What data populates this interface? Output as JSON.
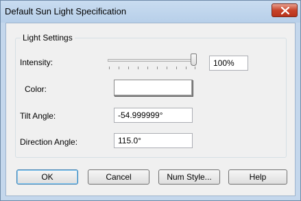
{
  "window": {
    "title": "Default Sun Light Specification"
  },
  "group": {
    "title": "Light Settings"
  },
  "intensity": {
    "label": "Intensity:",
    "value": "100%",
    "slider_fraction": 1.0
  },
  "color": {
    "label": "Color:",
    "swatch": "#ffffff"
  },
  "tilt": {
    "label": "Tilt Angle:",
    "value": "-54.999999°"
  },
  "direction": {
    "label": "Direction Angle:",
    "value": "115.0°"
  },
  "buttons": {
    "ok": "OK",
    "cancel": "Cancel",
    "num_style": "Num Style...",
    "help": "Help"
  },
  "icons": {
    "close": "close-icon"
  },
  "colors": {
    "close_button": "#c7432a",
    "frame": "#c4d7ec"
  }
}
